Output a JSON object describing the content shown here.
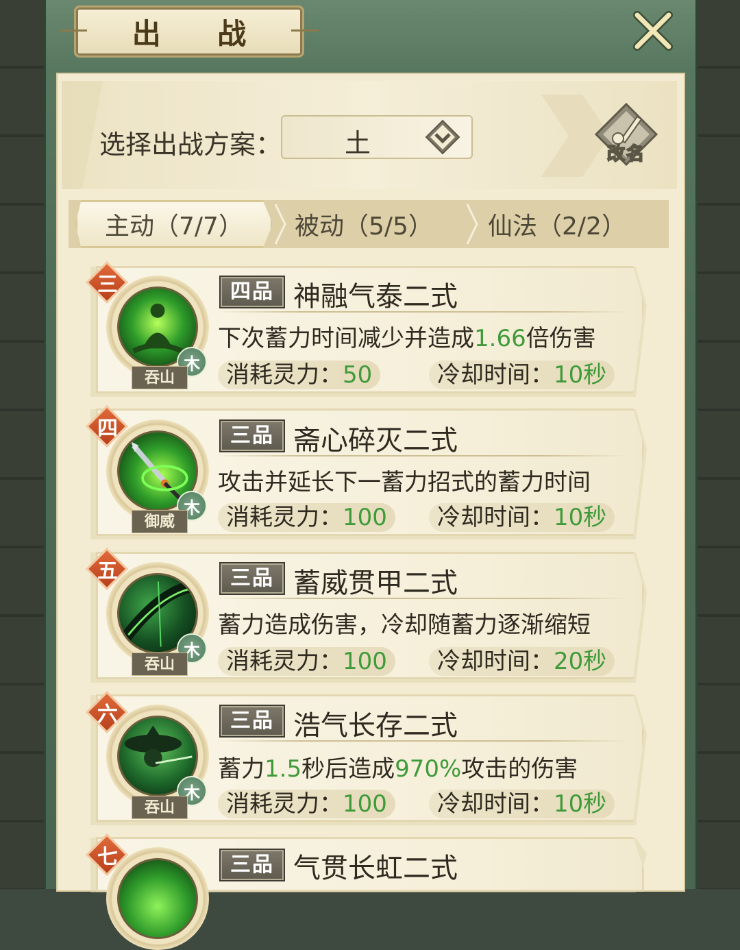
{
  "window": {
    "title": "出 战"
  },
  "scheme": {
    "label": "选择出战方案：",
    "value": "土",
    "rename_label": "改名"
  },
  "tabs": [
    {
      "label": "主动（7/7）",
      "active": true
    },
    {
      "label": "被动（5/5）",
      "active": false
    },
    {
      "label": "仙法（2/2）",
      "active": false
    }
  ],
  "skills": [
    {
      "order": "三",
      "grade": "四品",
      "name": "神融气泰二式",
      "desc_parts": [
        "下次蓄力时间减少并造成",
        "1.66",
        "倍伤害"
      ],
      "element": "木",
      "school": "吞山",
      "cost_label": "消耗灵力：",
      "cost": "50",
      "cooldown_label": "冷却时间：",
      "cooldown": "10秒"
    },
    {
      "order": "四",
      "grade": "三品",
      "name": "斋心碎灭二式",
      "desc_parts": [
        "攻击并延长下一蓄力招式的蓄力时间"
      ],
      "element": "木",
      "school": "御威",
      "cost_label": "消耗灵力：",
      "cost": "100",
      "cooldown_label": "冷却时间：",
      "cooldown": "10秒"
    },
    {
      "order": "五",
      "grade": "三品",
      "name": "蓄威贯甲二式",
      "desc_parts": [
        "蓄力造成伤害，冷却随蓄力逐渐缩短"
      ],
      "element": "木",
      "school": "吞山",
      "cost_label": "消耗灵力：",
      "cost": "100",
      "cooldown_label": "冷却时间：",
      "cooldown": "20秒"
    },
    {
      "order": "六",
      "grade": "三品",
      "name": "浩气长存二式",
      "desc_parts": [
        "蓄力",
        "1.5",
        "秒后造成",
        "970%",
        "攻击的伤害"
      ],
      "element": "木",
      "school": "吞山",
      "cost_label": "消耗灵力：",
      "cost": "100",
      "cooldown_label": "冷却时间：",
      "cooldown": "10秒"
    },
    {
      "order": "七",
      "grade": "三品",
      "name": "气贯长虹二式"
    }
  ],
  "colors": {
    "accent_green": "#3f9a3a",
    "order_badge": "#c9502a",
    "frame_green": "#4d6b55",
    "paper": "#f3ecd3"
  }
}
